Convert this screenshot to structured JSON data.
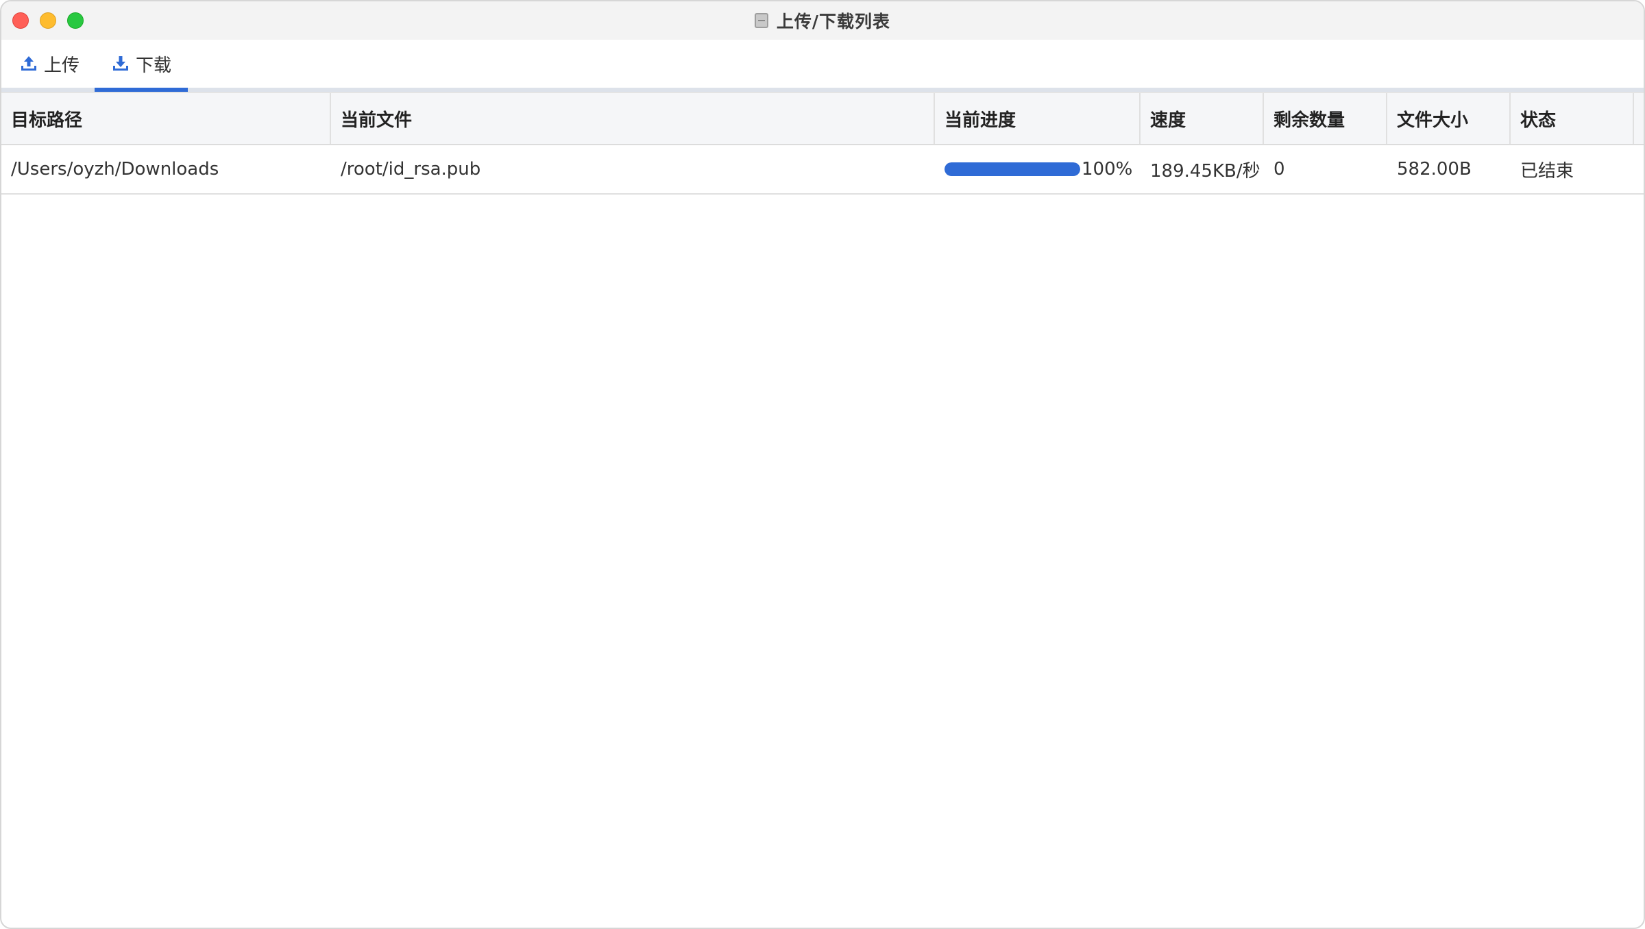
{
  "window": {
    "title": "上传/下载列表"
  },
  "tabs": [
    {
      "label": "上传",
      "icon": "upload-icon",
      "active": false
    },
    {
      "label": "下载",
      "icon": "download-icon",
      "active": true
    }
  ],
  "colors": {
    "accent": "#2f6bd6",
    "close": "#ff5f57",
    "minimize": "#febc2e",
    "maximize": "#28c840"
  },
  "table": {
    "headers": [
      "目标路径",
      "当前文件",
      "当前进度",
      "速度",
      "剩余数量",
      "文件大小",
      "状态"
    ],
    "rows": [
      {
        "target_path": "/Users/oyzh/Downloads",
        "current_file": "/root/id_rsa.pub",
        "progress": 1.0,
        "progress_text": "100%",
        "speed": "189.45KB/秒",
        "remaining": "0",
        "file_size": "582.00B",
        "status": "已结束"
      }
    ]
  }
}
